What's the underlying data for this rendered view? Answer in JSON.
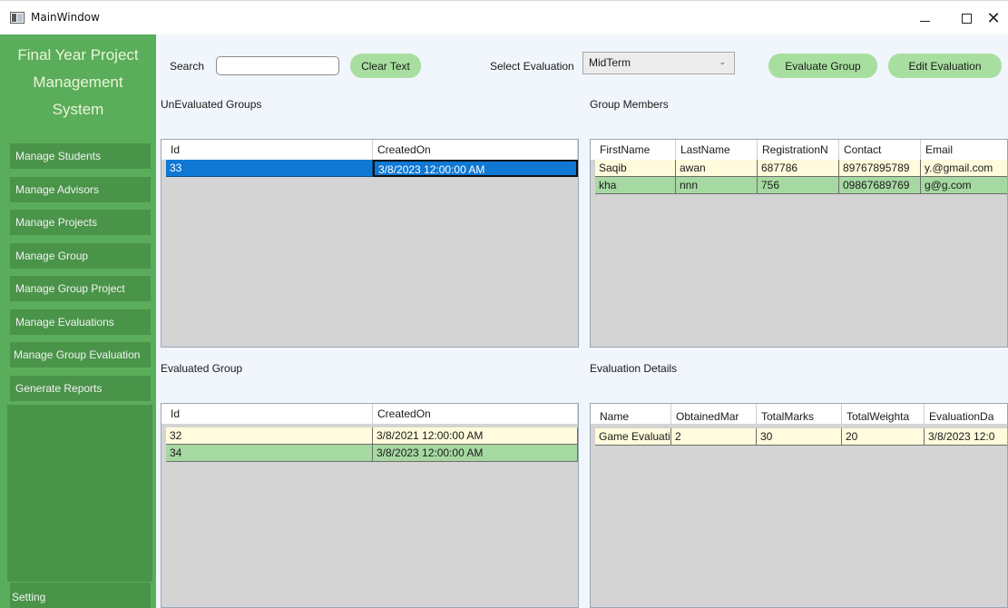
{
  "window": {
    "title": "MainWindow",
    "controls": {
      "minimize": "—",
      "maximize": "□",
      "close": "✕"
    }
  },
  "sidebar": {
    "brand_lines": [
      "Final Year Project",
      "Management",
      "System"
    ],
    "items": [
      {
        "label": "Manage Students"
      },
      {
        "label": "Manage Advisors"
      },
      {
        "label": "Manage Projects"
      },
      {
        "label": "Manage Group"
      },
      {
        "label": "Manage Group Project"
      },
      {
        "label": "Manage Evaluations"
      },
      {
        "label": "Manage Group Evaluation"
      },
      {
        "label": "Generate Reports"
      }
    ],
    "setting_label": "Setting"
  },
  "toolbar": {
    "search_label": "Search",
    "search_value": "",
    "clear_text_label": "Clear Text",
    "select_evaluation_label": "Select Evaluation",
    "evaluation_selected": "MidTerm",
    "evaluate_group_label": "Evaluate Group",
    "edit_evaluation_label": "Edit Evaluation"
  },
  "unevaluated_groups": {
    "title": "UnEvaluated Groups",
    "columns": [
      "Id",
      "CreatedOn"
    ],
    "rows": [
      [
        "33",
        "3/8/2023 12:00:00 AM"
      ]
    ]
  },
  "group_members": {
    "title": "Group Members",
    "columns": [
      "FirstName",
      "LastName",
      "RegistrationN",
      "Contact",
      "Email"
    ],
    "rows": [
      [
        "Saqib",
        "awan",
        "687786",
        "89767895789",
        "y.@gmail.com"
      ],
      [
        "kha",
        "nnn",
        "756",
        "09867689769",
        "g@g.com"
      ]
    ]
  },
  "evaluated_group": {
    "title": "Evaluated Group",
    "columns": [
      "Id",
      "CreatedOn"
    ],
    "rows": [
      [
        "32",
        "3/8/2021 12:00:00 AM"
      ],
      [
        "34",
        "3/8/2023 12:00:00 AM"
      ]
    ]
  },
  "evaluation_details": {
    "title": "Evaluation Details",
    "columns": [
      "Name",
      "ObtainedMar",
      "TotalMarks",
      "TotalWeighta",
      "EvaluationDa"
    ],
    "rows": [
      [
        "Game Evaluati",
        "2",
        "30",
        "20",
        "3/8/2023 12:0"
      ]
    ]
  },
  "colors": {
    "sidebar_bg": "#5aad5a",
    "nav_item_bg": "#4a944a",
    "pill_button_bg": "#a8dfa0",
    "row_yellow": "#fffbdc",
    "row_green": "#a6d9a2",
    "row_selected": "#0f78d4",
    "content_bg": "#f0f6fc"
  }
}
